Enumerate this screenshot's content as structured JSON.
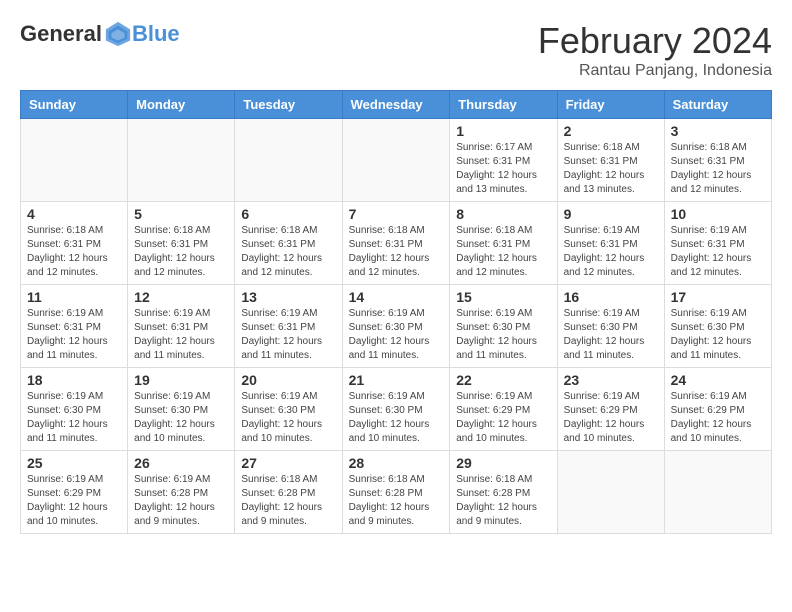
{
  "header": {
    "logo_general": "General",
    "logo_blue": "Blue",
    "month_title": "February 2024",
    "location": "Rantau Panjang, Indonesia"
  },
  "weekdays": [
    "Sunday",
    "Monday",
    "Tuesday",
    "Wednesday",
    "Thursday",
    "Friday",
    "Saturday"
  ],
  "weeks": [
    [
      {
        "day": "",
        "info": ""
      },
      {
        "day": "",
        "info": ""
      },
      {
        "day": "",
        "info": ""
      },
      {
        "day": "",
        "info": ""
      },
      {
        "day": "1",
        "info": "Sunrise: 6:17 AM\nSunset: 6:31 PM\nDaylight: 12 hours\nand 13 minutes."
      },
      {
        "day": "2",
        "info": "Sunrise: 6:18 AM\nSunset: 6:31 PM\nDaylight: 12 hours\nand 13 minutes."
      },
      {
        "day": "3",
        "info": "Sunrise: 6:18 AM\nSunset: 6:31 PM\nDaylight: 12 hours\nand 12 minutes."
      }
    ],
    [
      {
        "day": "4",
        "info": "Sunrise: 6:18 AM\nSunset: 6:31 PM\nDaylight: 12 hours\nand 12 minutes."
      },
      {
        "day": "5",
        "info": "Sunrise: 6:18 AM\nSunset: 6:31 PM\nDaylight: 12 hours\nand 12 minutes."
      },
      {
        "day": "6",
        "info": "Sunrise: 6:18 AM\nSunset: 6:31 PM\nDaylight: 12 hours\nand 12 minutes."
      },
      {
        "day": "7",
        "info": "Sunrise: 6:18 AM\nSunset: 6:31 PM\nDaylight: 12 hours\nand 12 minutes."
      },
      {
        "day": "8",
        "info": "Sunrise: 6:18 AM\nSunset: 6:31 PM\nDaylight: 12 hours\nand 12 minutes."
      },
      {
        "day": "9",
        "info": "Sunrise: 6:19 AM\nSunset: 6:31 PM\nDaylight: 12 hours\nand 12 minutes."
      },
      {
        "day": "10",
        "info": "Sunrise: 6:19 AM\nSunset: 6:31 PM\nDaylight: 12 hours\nand 12 minutes."
      }
    ],
    [
      {
        "day": "11",
        "info": "Sunrise: 6:19 AM\nSunset: 6:31 PM\nDaylight: 12 hours\nand 11 minutes."
      },
      {
        "day": "12",
        "info": "Sunrise: 6:19 AM\nSunset: 6:31 PM\nDaylight: 12 hours\nand 11 minutes."
      },
      {
        "day": "13",
        "info": "Sunrise: 6:19 AM\nSunset: 6:31 PM\nDaylight: 12 hours\nand 11 minutes."
      },
      {
        "day": "14",
        "info": "Sunrise: 6:19 AM\nSunset: 6:30 PM\nDaylight: 12 hours\nand 11 minutes."
      },
      {
        "day": "15",
        "info": "Sunrise: 6:19 AM\nSunset: 6:30 PM\nDaylight: 12 hours\nand 11 minutes."
      },
      {
        "day": "16",
        "info": "Sunrise: 6:19 AM\nSunset: 6:30 PM\nDaylight: 12 hours\nand 11 minutes."
      },
      {
        "day": "17",
        "info": "Sunrise: 6:19 AM\nSunset: 6:30 PM\nDaylight: 12 hours\nand 11 minutes."
      }
    ],
    [
      {
        "day": "18",
        "info": "Sunrise: 6:19 AM\nSunset: 6:30 PM\nDaylight: 12 hours\nand 11 minutes."
      },
      {
        "day": "19",
        "info": "Sunrise: 6:19 AM\nSunset: 6:30 PM\nDaylight: 12 hours\nand 10 minutes."
      },
      {
        "day": "20",
        "info": "Sunrise: 6:19 AM\nSunset: 6:30 PM\nDaylight: 12 hours\nand 10 minutes."
      },
      {
        "day": "21",
        "info": "Sunrise: 6:19 AM\nSunset: 6:30 PM\nDaylight: 12 hours\nand 10 minutes."
      },
      {
        "day": "22",
        "info": "Sunrise: 6:19 AM\nSunset: 6:29 PM\nDaylight: 12 hours\nand 10 minutes."
      },
      {
        "day": "23",
        "info": "Sunrise: 6:19 AM\nSunset: 6:29 PM\nDaylight: 12 hours\nand 10 minutes."
      },
      {
        "day": "24",
        "info": "Sunrise: 6:19 AM\nSunset: 6:29 PM\nDaylight: 12 hours\nand 10 minutes."
      }
    ],
    [
      {
        "day": "25",
        "info": "Sunrise: 6:19 AM\nSunset: 6:29 PM\nDaylight: 12 hours\nand 10 minutes."
      },
      {
        "day": "26",
        "info": "Sunrise: 6:19 AM\nSunset: 6:28 PM\nDaylight: 12 hours\nand 9 minutes."
      },
      {
        "day": "27",
        "info": "Sunrise: 6:18 AM\nSunset: 6:28 PM\nDaylight: 12 hours\nand 9 minutes."
      },
      {
        "day": "28",
        "info": "Sunrise: 6:18 AM\nSunset: 6:28 PM\nDaylight: 12 hours\nand 9 minutes."
      },
      {
        "day": "29",
        "info": "Sunrise: 6:18 AM\nSunset: 6:28 PM\nDaylight: 12 hours\nand 9 minutes."
      },
      {
        "day": "",
        "info": ""
      },
      {
        "day": "",
        "info": ""
      }
    ]
  ]
}
